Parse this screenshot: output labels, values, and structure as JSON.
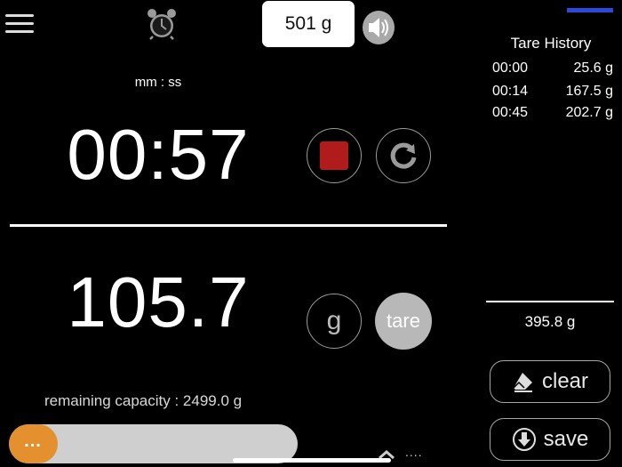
{
  "top": {
    "target_weight": "501 g",
    "icons": {
      "menu": "menu-icon",
      "alarm": "alarm-clock-icon",
      "sound": "speaker-icon"
    }
  },
  "timer": {
    "format_label": "mm : ss",
    "value": "00:57",
    "icons": {
      "stop": "stop-icon",
      "reset": "reset-icon"
    }
  },
  "scale": {
    "weight": "105.7",
    "unit": "g",
    "tare_label": "tare",
    "remaining_capacity": "remaining capacity : 2499.0 g"
  },
  "progress": {
    "fraction": 0.17,
    "handle_label": "...",
    "more_label": "...."
  },
  "history": {
    "title": "Tare History",
    "rows": [
      {
        "time": "00:00",
        "value": "25.6 g"
      },
      {
        "time": "00:14",
        "value": "167.5 g"
      },
      {
        "time": "00:45",
        "value": "202.7 g"
      }
    ],
    "total": "395.8 g"
  },
  "actions": {
    "clear_label": "clear",
    "save_label": "save"
  },
  "colors": {
    "stop": "#b01c1c",
    "progress_fill": "#e5902e",
    "accent": "#2a4bd9"
  }
}
